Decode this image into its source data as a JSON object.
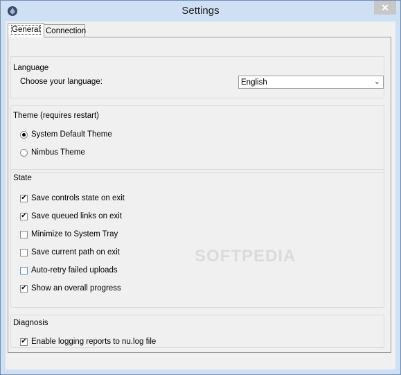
{
  "window": {
    "title": "Settings",
    "close_glyph": "✕",
    "icon": "app-icon"
  },
  "tabs": [
    {
      "label": "General",
      "active": true
    },
    {
      "label": "Connection",
      "active": false
    }
  ],
  "language": {
    "group_title": "Language",
    "prompt": "Choose your language:",
    "selected": "English"
  },
  "theme": {
    "group_title": "Theme (requires restart)",
    "options": [
      {
        "label": "System Default Theme",
        "selected": true
      },
      {
        "label": "Nimbus Theme",
        "selected": false
      }
    ]
  },
  "state": {
    "group_title": "State",
    "options": [
      {
        "label": "Save controls state on exit",
        "checked": true
      },
      {
        "label": "Save queued links on exit",
        "checked": true
      },
      {
        "label": "Minimize to System Tray",
        "checked": false
      },
      {
        "label": "Save current path on exit",
        "checked": false
      },
      {
        "label": "Auto-retry failed uploads",
        "checked": false
      },
      {
        "label": "Show an overall progress",
        "checked": true
      }
    ]
  },
  "diagnosis": {
    "group_title": "Diagnosis",
    "options": [
      {
        "label": "Enable logging reports to nu.log file",
        "checked": true
      }
    ]
  },
  "watermark": "SOFTPEDIA"
}
